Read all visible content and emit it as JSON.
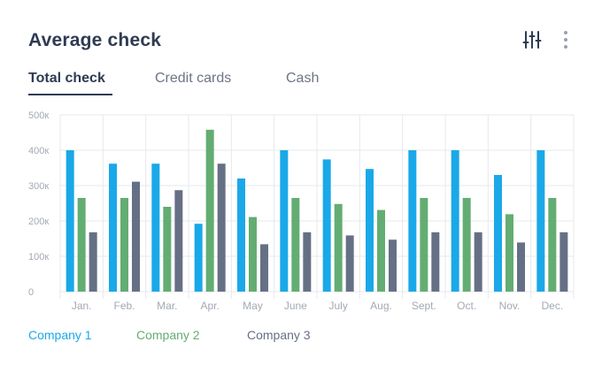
{
  "header": {
    "title": "Average check",
    "filter_icon": "sliders-icon",
    "more_icon": "more-vertical-icon"
  },
  "tabs": [
    {
      "label": "Total check",
      "active": true
    },
    {
      "label": "Credit cards",
      "active": false
    },
    {
      "label": "Cash",
      "active": false
    }
  ],
  "colors": {
    "company1": "#1aa8e8",
    "company2": "#63ad72",
    "company3": "#667085",
    "grid": "#e6e8ec",
    "tick": "#a3a9b3"
  },
  "chart_data": {
    "type": "bar",
    "categories": [
      "Jan.",
      "Feb.",
      "Mar.",
      "Apr.",
      "May",
      "June",
      "July",
      "Aug.",
      "Sept.",
      "Oct.",
      "Nov.",
      "Dec."
    ],
    "series": [
      {
        "name": "Company 1",
        "values": [
          400,
          362,
          362,
          192,
          320,
          400,
          374,
          347,
          400,
          400,
          330,
          400
        ]
      },
      {
        "name": "Company 2",
        "values": [
          265,
          265,
          240,
          458,
          211,
          265,
          248,
          231,
          265,
          265,
          219,
          265
        ]
      },
      {
        "name": "Company 3",
        "values": [
          168,
          311,
          287,
          362,
          134,
          168,
          159,
          147,
          168,
          168,
          139,
          168
        ]
      }
    ],
    "yticks": [
      "0",
      "100к",
      "200к",
      "300к",
      "400к",
      "500к"
    ],
    "ylim": [
      0,
      500
    ],
    "grid": true,
    "legend_position": "bottom-left"
  },
  "legend": [
    {
      "label": "Company 1"
    },
    {
      "label": "Company 2"
    },
    {
      "label": "Company 3"
    }
  ]
}
